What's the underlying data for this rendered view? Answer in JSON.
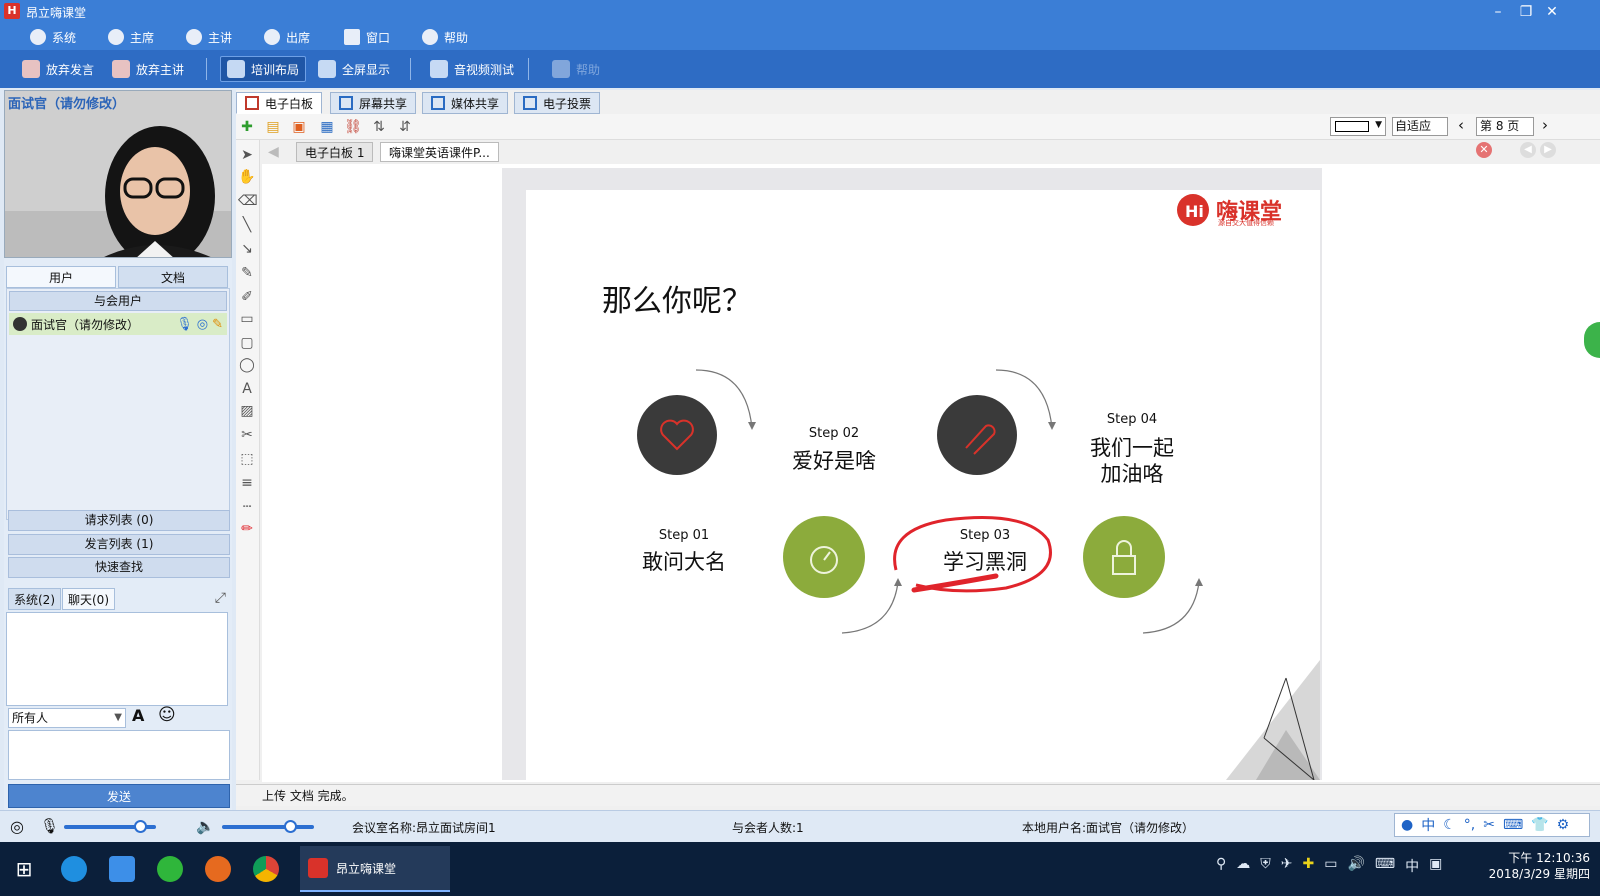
{
  "app": {
    "title": "昂立嗨课堂"
  },
  "menu": [
    "系统",
    "主席",
    "主讲",
    "出席",
    "窗口",
    "帮助"
  ],
  "toolbar": {
    "give_up_speak": "放弃发言",
    "give_up_lecture": "放弃主讲",
    "training_layout": "培训布局",
    "fullscreen": "全屏显示",
    "av_test": "音视频测试",
    "help_label": "帮助"
  },
  "video": {
    "name": "面试官（请勿修改）"
  },
  "panel_tabs": {
    "users": "用户",
    "docs": "文档"
  },
  "participants": {
    "header": "与会用户",
    "users": [
      {
        "name": "面试官（请勿修改）"
      }
    ]
  },
  "lists": {
    "request": "请求列表 (0)",
    "speaking": "发言列表 (1)",
    "quick_search": "快速查找"
  },
  "chat": {
    "tab_system": "系统(2)",
    "tab_chat": "聊天(0)",
    "recipient": "所有人",
    "send": "发送"
  },
  "main_tabs": [
    "电子白板",
    "屏幕共享",
    "媒体共享",
    "电子投票"
  ],
  "wb": {
    "fit_mode": "自适应",
    "page": "第 8 页",
    "doc_tabs": [
      "电子白板 1",
      "嗨课堂英语课件P..."
    ]
  },
  "slide": {
    "brand": "嗨课堂",
    "brand_sub": "源自交大值得信赖",
    "title": "那么你呢？",
    "steps": [
      {
        "step": "Step 01",
        "text": "敢问大名"
      },
      {
        "step": "Step 02",
        "text": "爱好是啥"
      },
      {
        "step": "Step 03",
        "text": "学习黑洞"
      },
      {
        "step": "Step 04",
        "text_line1": "我们一起",
        "text_line2": "加油咯"
      }
    ]
  },
  "status": {
    "message": "上传 文档 完成。"
  },
  "bottom": {
    "room": "会议室名称:昂立面试房间1",
    "count": "与会者人数:1",
    "local_user": "本地用户名:面试官（请勿修改）"
  },
  "taskbar": {
    "active_app": "昂立嗨课堂",
    "time": "下午 12:10:36",
    "date": "2018/3/29 星期四",
    "ime": "中"
  },
  "colors": {
    "title_bar": "#3b7ed6",
    "toolbar": "#2e6cc4",
    "circle_dark": "#3a3a3a",
    "circle_green": "#8cab3c",
    "annotation_red": "#e0242b"
  }
}
